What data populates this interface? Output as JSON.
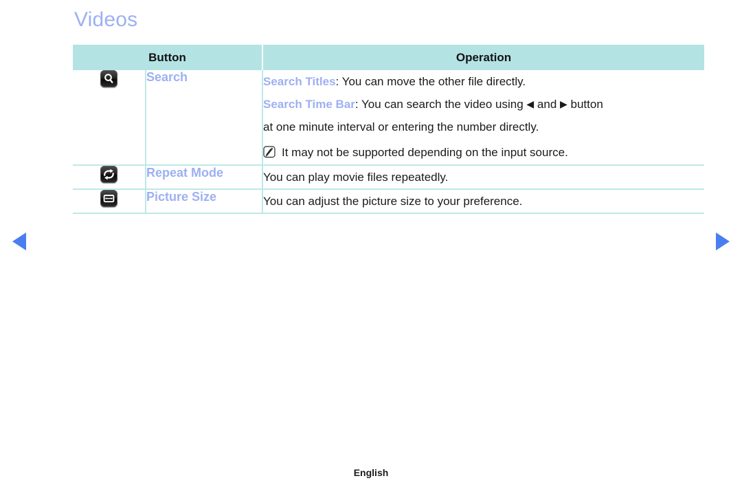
{
  "page": {
    "title": "Videos",
    "language_footer": "English",
    "accent_blue": "#9db0f2",
    "header_cyan": "#b4e3e4",
    "border_cyan": "#bfe7e8",
    "arrow_blue": "#4a7ef0"
  },
  "nav": {
    "prev_label": "◀",
    "next_label": "▶"
  },
  "table": {
    "headers": {
      "button": "Button",
      "operation": "Operation"
    },
    "rows": [
      {
        "icon": "search-icon",
        "name": "Search",
        "lines": [
          {
            "term": "Search Titles",
            "separator": ": ",
            "text": "You can move the other file directly."
          },
          {
            "term": "Search Time Bar",
            "separator": ": ",
            "text_before_arrows": "You can search the video using ",
            "arrow_left": "◀",
            "text_between_arrows": " and ",
            "arrow_right": "▶",
            "text_after_arrows": " button"
          },
          {
            "term": "",
            "separator": "",
            "text": "at one minute interval or entering the number directly."
          }
        ],
        "note": "It may not be supported depending on the input source."
      },
      {
        "icon": "repeat-icon",
        "name": "Repeat Mode",
        "lines": [
          {
            "term": "",
            "separator": "",
            "text": "You can play movie files repeatedly."
          }
        ],
        "note": ""
      },
      {
        "icon": "picture-size-icon",
        "name": "Picture Size",
        "lines": [
          {
            "term": "",
            "separator": "",
            "text": "You can adjust the picture size to your preference."
          }
        ],
        "note": ""
      }
    ]
  }
}
